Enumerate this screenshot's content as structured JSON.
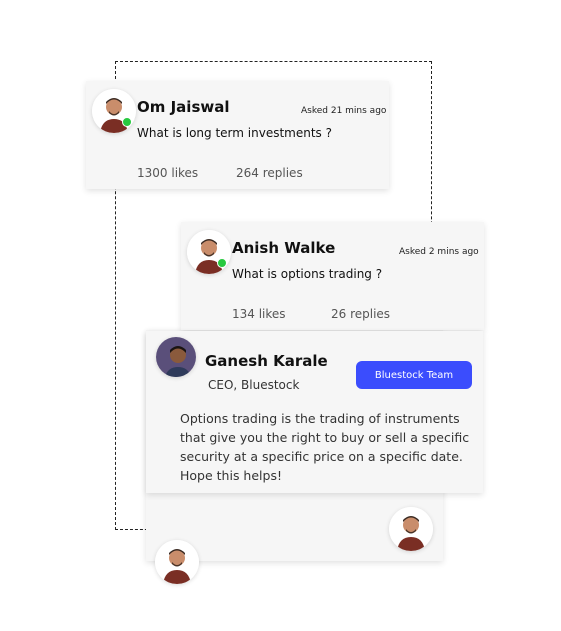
{
  "questions": [
    {
      "name": "Om Jaiswal",
      "asked": "Asked 21 mins ago",
      "question": "What is long term investments ?",
      "likes": "1300 likes",
      "replies": "264 replies"
    },
    {
      "name": "Anish Walke",
      "asked": "Asked 2 mins ago",
      "question": "What is options trading ?",
      "likes": "134 likes",
      "replies": "26 replies"
    }
  ],
  "answer": {
    "name": "Ganesh Karale",
    "role": "CEO, Bluestock",
    "badge": "Bluestock Team",
    "text_lines": [
      "Options trading is the trading of instruments",
      "that give you the right to buy or sell a specific",
      "security at a specific price on a specific date.",
      "Hope this helps!"
    ]
  },
  "colors": {
    "badge_bg": "#3b4dfd",
    "online": "#27c93f",
    "card_bg": "#f6f6f6"
  }
}
